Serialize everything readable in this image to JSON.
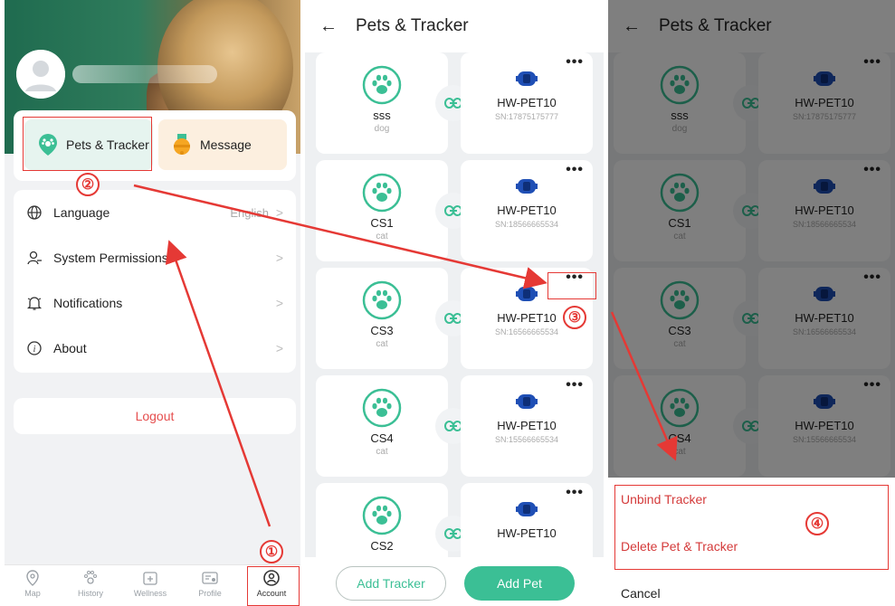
{
  "account": {
    "quick": {
      "pets": "Pets & Tracker",
      "message": "Message"
    },
    "menu": [
      {
        "label": "Language",
        "value": "English"
      },
      {
        "label": "System Permissions",
        "value": ""
      },
      {
        "label": "Notifications",
        "value": ""
      },
      {
        "label": "About",
        "value": ""
      }
    ],
    "logout": "Logout",
    "tabs": [
      "Map",
      "History",
      "Wellness",
      "Profile",
      "Account"
    ]
  },
  "pets_screen": {
    "title": "Pets & Tracker",
    "pairs": [
      {
        "pet": "sss",
        "type": "dog",
        "tracker": "HW-PET10",
        "sn": "SN:17875175777"
      },
      {
        "pet": "CS1",
        "type": "cat",
        "tracker": "HW-PET10",
        "sn": "SN:18566665534"
      },
      {
        "pet": "CS3",
        "type": "cat",
        "tracker": "HW-PET10",
        "sn": "SN:16566665534"
      },
      {
        "pet": "CS4",
        "type": "cat",
        "tracker": "HW-PET10",
        "sn": "SN:15566665534"
      },
      {
        "pet": "CS2",
        "type": "",
        "tracker": "HW-PET10",
        "sn": ""
      }
    ],
    "more": "•••",
    "add_tracker": "Add Tracker",
    "add_pet": "Add Pet"
  },
  "action_sheet": {
    "unbind": "Unbind Tracker",
    "delete": "Delete Pet & Tracker",
    "cancel": "Cancel"
  },
  "callouts": [
    "①",
    "②",
    "③",
    "④"
  ],
  "colors": {
    "brand_green": "#3bbf95",
    "highlight_red": "#e53935",
    "tracker_blue": "#1f4fb5"
  }
}
